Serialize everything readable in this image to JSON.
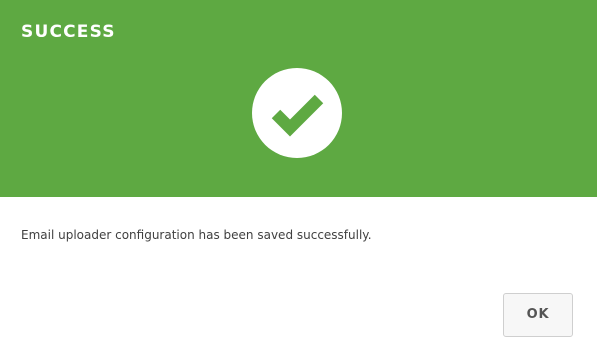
{
  "dialog": {
    "title": "SUCCESS",
    "icon": "check-circle-icon",
    "message": "Email uploader configuration has been saved successfully.",
    "ok_label": "OK"
  },
  "colors": {
    "header_bg": "#5ea942",
    "icon_fg": "#5ea942",
    "text": "#404040",
    "button_bg": "#f7f7f7",
    "button_border": "#cfcfcf"
  }
}
